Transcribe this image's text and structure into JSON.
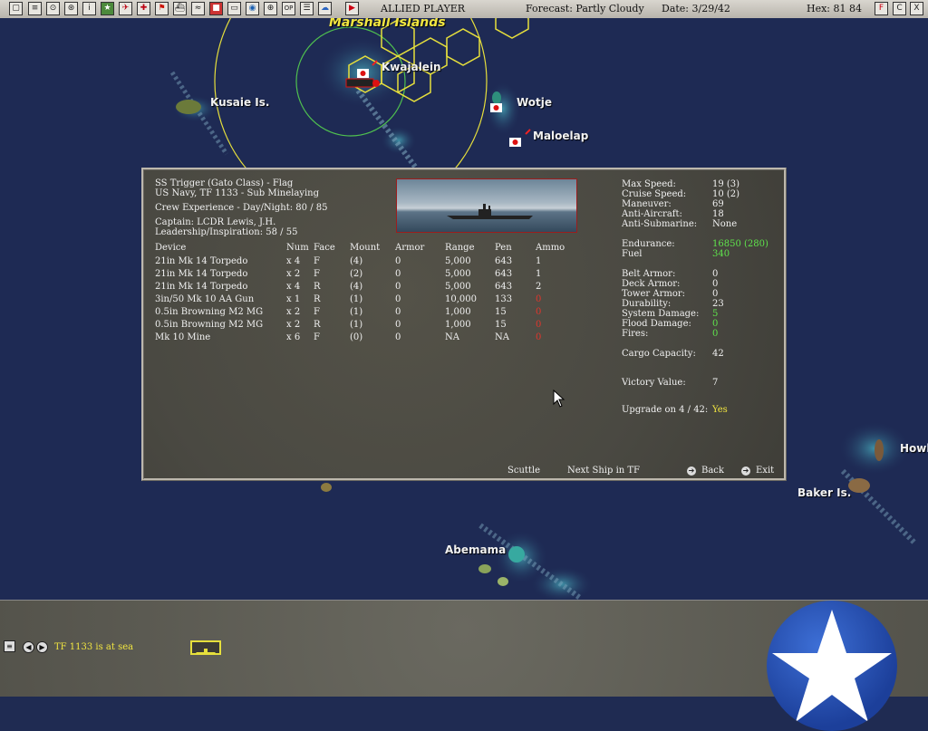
{
  "toolbar": {
    "player": "ALLIED PLAYER",
    "forecast": "Forecast: Partly Cloudy",
    "date": "Date: 3/29/42",
    "hex": "Hex: 81 84",
    "icons_left": [
      "map-icon",
      "report-icon",
      "tf-icon",
      "base-icon",
      "intel-icon",
      "ground-icon",
      "air-icon",
      "air2-icon",
      "flag-icon",
      "ship-icon",
      "sub-icon",
      "resource-icon",
      "save-icon",
      "globe-icon",
      "zoom-icon",
      "op-icon",
      "list-icon",
      "weather-icon",
      "play-icon"
    ],
    "op_label": "OP",
    "flag_label": "F",
    "c_label": "C",
    "x_label": "X"
  },
  "map": {
    "labels": {
      "marshall": "Marshall Islands",
      "kwajalein": "Kwajalein",
      "kusaie": "Kusaie Is.",
      "wotje": "Wotje",
      "maloelap": "Maloelap",
      "abemama": "Abemama",
      "howland": "Howl",
      "baker": "Baker Is."
    }
  },
  "panel": {
    "title": "SS Trigger (Gato Class) - Flag",
    "subtitle": "US Navy, TF 1133 - Sub Minelaying",
    "crew": "Crew Experience - Day/Night: 80 / 85",
    "captain": "Captain:  LCDR Lewis, J.H.",
    "leadership": "Leadership/Inspiration: 58 / 55",
    "columns": [
      "Device",
      "Num",
      "Face",
      "Mount",
      "Armor",
      "Range",
      "Pen",
      "Ammo"
    ],
    "devices": [
      {
        "device": "21in Mk 14 Torpedo",
        "num": "x 4",
        "face": "F",
        "mount": "(4)",
        "armor": "0",
        "range": "5,000",
        "pen": "643",
        "ammo": "1",
        "ammo_red": false
      },
      {
        "device": "21in Mk 14 Torpedo",
        "num": "x 2",
        "face": "F",
        "mount": "(2)",
        "armor": "0",
        "range": "5,000",
        "pen": "643",
        "ammo": "1",
        "ammo_red": false
      },
      {
        "device": "21in Mk 14 Torpedo",
        "num": "x 4",
        "face": "R",
        "mount": "(4)",
        "armor": "0",
        "range": "5,000",
        "pen": "643",
        "ammo": "2",
        "ammo_red": false
      },
      {
        "device": "3in/50 Mk 10 AA Gun",
        "num": "x 1",
        "face": "R",
        "mount": "(1)",
        "armor": "0",
        "range": "10,000",
        "pen": "133",
        "ammo": "0",
        "ammo_red": true
      },
      {
        "device": "0.5in Browning M2 MG",
        "num": "x 2",
        "face": "F",
        "mount": "(1)",
        "armor": "0",
        "range": "1,000",
        "pen": "15",
        "ammo": "0",
        "ammo_red": true
      },
      {
        "device": "0.5in Browning M2 MG",
        "num": "x 2",
        "face": "R",
        "mount": "(1)",
        "armor": "0",
        "range": "1,000",
        "pen": "15",
        "ammo": "0",
        "ammo_red": true
      },
      {
        "device": "Mk 10 Mine",
        "num": "x 6",
        "face": "F",
        "mount": "(0)",
        "armor": "0",
        "range": "NA",
        "pen": "NA",
        "ammo": "0",
        "ammo_red": true
      }
    ],
    "stats": {
      "max_speed_label": "Max Speed:",
      "max_speed": "19 (3)",
      "cruise_speed_label": "Cruise Speed:",
      "cruise_speed": "10 (2)",
      "maneuver_label": "Maneuver:",
      "maneuver": "69",
      "aa_label": "Anti-Aircraft:",
      "aa": "18",
      "asw_label": "Anti-Submarine:",
      "asw": "None",
      "endurance_label": "Endurance:",
      "endurance": "16850 (280)",
      "fuel_label": "Fuel",
      "fuel": "340",
      "belt_label": "Belt Armor:",
      "belt": "0",
      "deck_label": "Deck Armor:",
      "deck": "0",
      "tower_label": "Tower Armor:",
      "tower": "0",
      "durability_label": "Durability:",
      "durability": "23",
      "sysdmg_label": "System Damage:",
      "sysdmg": "5",
      "flood_label": "Flood Damage:",
      "flood": "0",
      "fires_label": "Fires:",
      "fires": "0",
      "cargo_label": "Cargo Capacity:",
      "cargo": "42",
      "victory_label": "Victory Value:",
      "victory": "7",
      "upgrade_label": "Upgrade on 4 / 42:",
      "upgrade": "Yes"
    },
    "buttons": {
      "scuttle": "Scuttle",
      "next_ship": "Next Ship in TF",
      "back": "Back",
      "exit": "Exit"
    }
  },
  "bottom": {
    "status": "TF 1133 is at sea"
  },
  "colors": {
    "accent_yellow": "#f2e640",
    "green": "#5fe34c",
    "red": "#e0352c"
  }
}
